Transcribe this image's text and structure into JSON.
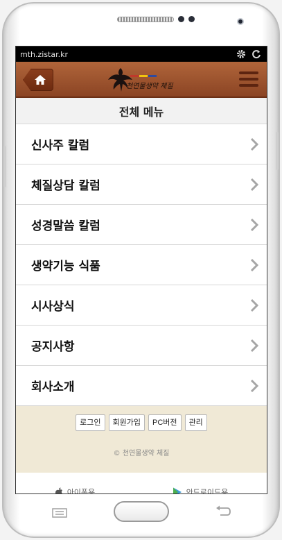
{
  "statusbar": {
    "url": "mth.zistar.kr",
    "icons": [
      "gear-icon",
      "refresh-icon"
    ]
  },
  "header": {
    "home_icon": "home-icon",
    "logo_text": "천연물생약 체질",
    "menu_icon": "hamburger-icon",
    "logo_stripe_colors": [
      "#c0392b",
      "#f1c40f",
      "#2e4aa0"
    ]
  },
  "menu": {
    "title": "전체 메뉴",
    "items": [
      {
        "label": "신사주 칼럼"
      },
      {
        "label": "체질상담 칼럼"
      },
      {
        "label": "성경말씀 칼럼"
      },
      {
        "label": "생약기능 식품"
      },
      {
        "label": "시사상식"
      },
      {
        "label": "공지사항"
      },
      {
        "label": "회사소개"
      }
    ]
  },
  "footer": {
    "buttons": [
      {
        "label": "로그인"
      },
      {
        "label": "회원가입"
      },
      {
        "label": "PC버전"
      },
      {
        "label": "관리"
      }
    ],
    "copyright": "© 천연물생약 체질"
  },
  "apps": [
    {
      "label": "아이폰용",
      "icon": "apple-icon"
    },
    {
      "label": "안드로이드용",
      "icon": "play-store-icon"
    }
  ],
  "colors": {
    "appbar": "#9c5230",
    "footer_bg": "#f0e9d6"
  }
}
